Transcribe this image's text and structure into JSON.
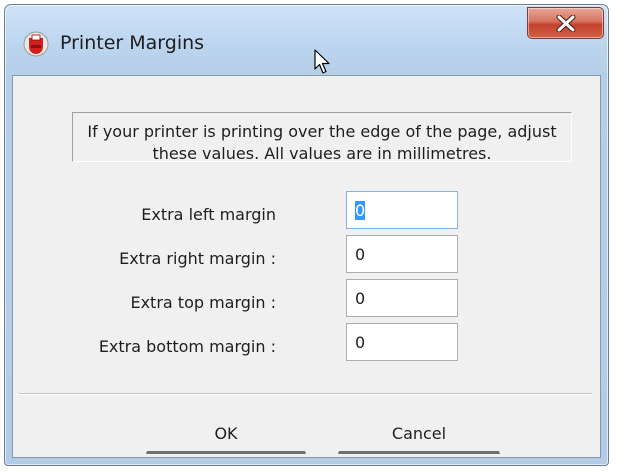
{
  "window": {
    "title": "Printer Margins"
  },
  "dialog": {
    "info_text": "If your printer is printing over the edge of the page, adjust these values. All values are in millimetres.",
    "fields": [
      {
        "label": "Extra left margin",
        "value": "0"
      },
      {
        "label": "Extra right margin :",
        "value": "0"
      },
      {
        "label": "Extra top margin :",
        "value": "0"
      },
      {
        "label": "Extra bottom margin :",
        "value": "0"
      }
    ],
    "ok_label": "OK",
    "cancel_label": "Cancel"
  },
  "colors": {
    "titlebar": "#bcd5ef",
    "close_button": "#c4422d",
    "dialog_background": "#f0f0f0",
    "selection": "#3399ff"
  },
  "icons": [
    "app-icon",
    "close-icon",
    "mouse-cursor-icon"
  ]
}
